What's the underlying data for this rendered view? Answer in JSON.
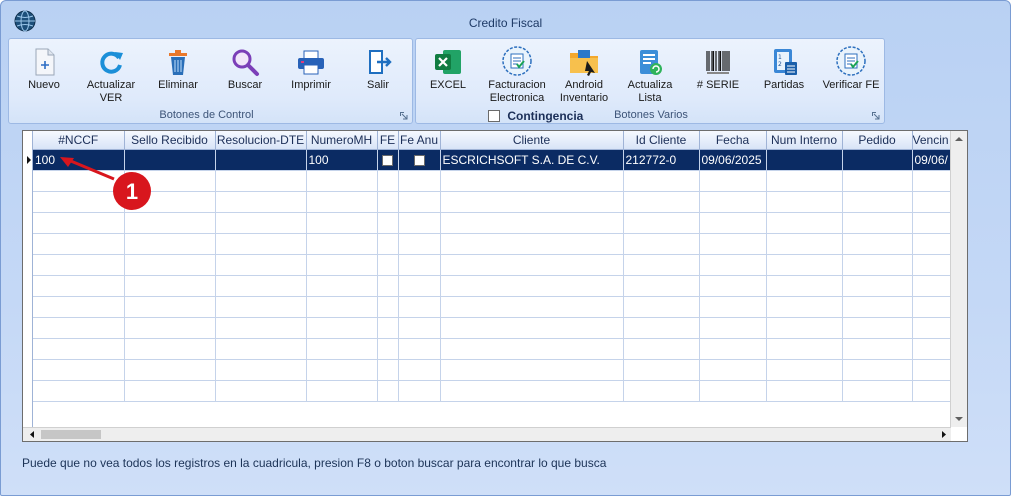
{
  "window": {
    "title": "Credito Fiscal"
  },
  "control_group": {
    "label": "Botones de Control",
    "buttons": [
      {
        "id": "nuevo",
        "label": "Nuevo"
      },
      {
        "id": "actualizar",
        "label": "Actualizar VER"
      },
      {
        "id": "eliminar",
        "label": "Eliminar"
      },
      {
        "id": "buscar",
        "label": "Buscar"
      },
      {
        "id": "imprimir",
        "label": "Imprimir"
      },
      {
        "id": "salir",
        "label": "Salir"
      }
    ]
  },
  "misc_group": {
    "label": "Botones Varios",
    "contingencia_label": "Contingencia",
    "contingencia_checked": false,
    "buttons": [
      {
        "id": "excel",
        "label": "EXCEL"
      },
      {
        "id": "facturacion",
        "label": "Facturacion Electronica"
      },
      {
        "id": "android",
        "label": "Android Inventario"
      },
      {
        "id": "actualiza_lista",
        "label": "Actualiza Lista"
      },
      {
        "id": "serie",
        "label": "# SERIE"
      },
      {
        "id": "partidas",
        "label": "Partidas"
      },
      {
        "id": "verificar",
        "label": "Verificar FE"
      }
    ]
  },
  "grid": {
    "columns": [
      "#NCCF",
      "Sello Recibido",
      "Resolucion-DTE",
      "NumeroMH",
      "FE",
      "Fe Anu",
      "Cliente",
      "Id Cliente",
      "Fecha",
      "Num Interno",
      "Pedido",
      "Vencin"
    ],
    "rows": [
      {
        "nccf": "100",
        "sello": "",
        "resolucion": "",
        "numeromh": "100",
        "fe": false,
        "fe_anu": false,
        "cliente": "ESCRICHSOFT S.A. DE C.V.",
        "id_cliente": "212772-0",
        "fecha": "09/06/2025",
        "num_interno": "",
        "pedido": "",
        "vencimiento": "09/06/"
      }
    ]
  },
  "annotation": {
    "number": "1"
  },
  "status": {
    "text": "Puede que no vea todos los registros en la cuadricula, presion F8 o boton buscar para encontrar lo que busca"
  },
  "colors": {
    "selected_row": "#0b2b63",
    "window_bg": "#c4d8f6",
    "annotation": "#d8161d"
  }
}
